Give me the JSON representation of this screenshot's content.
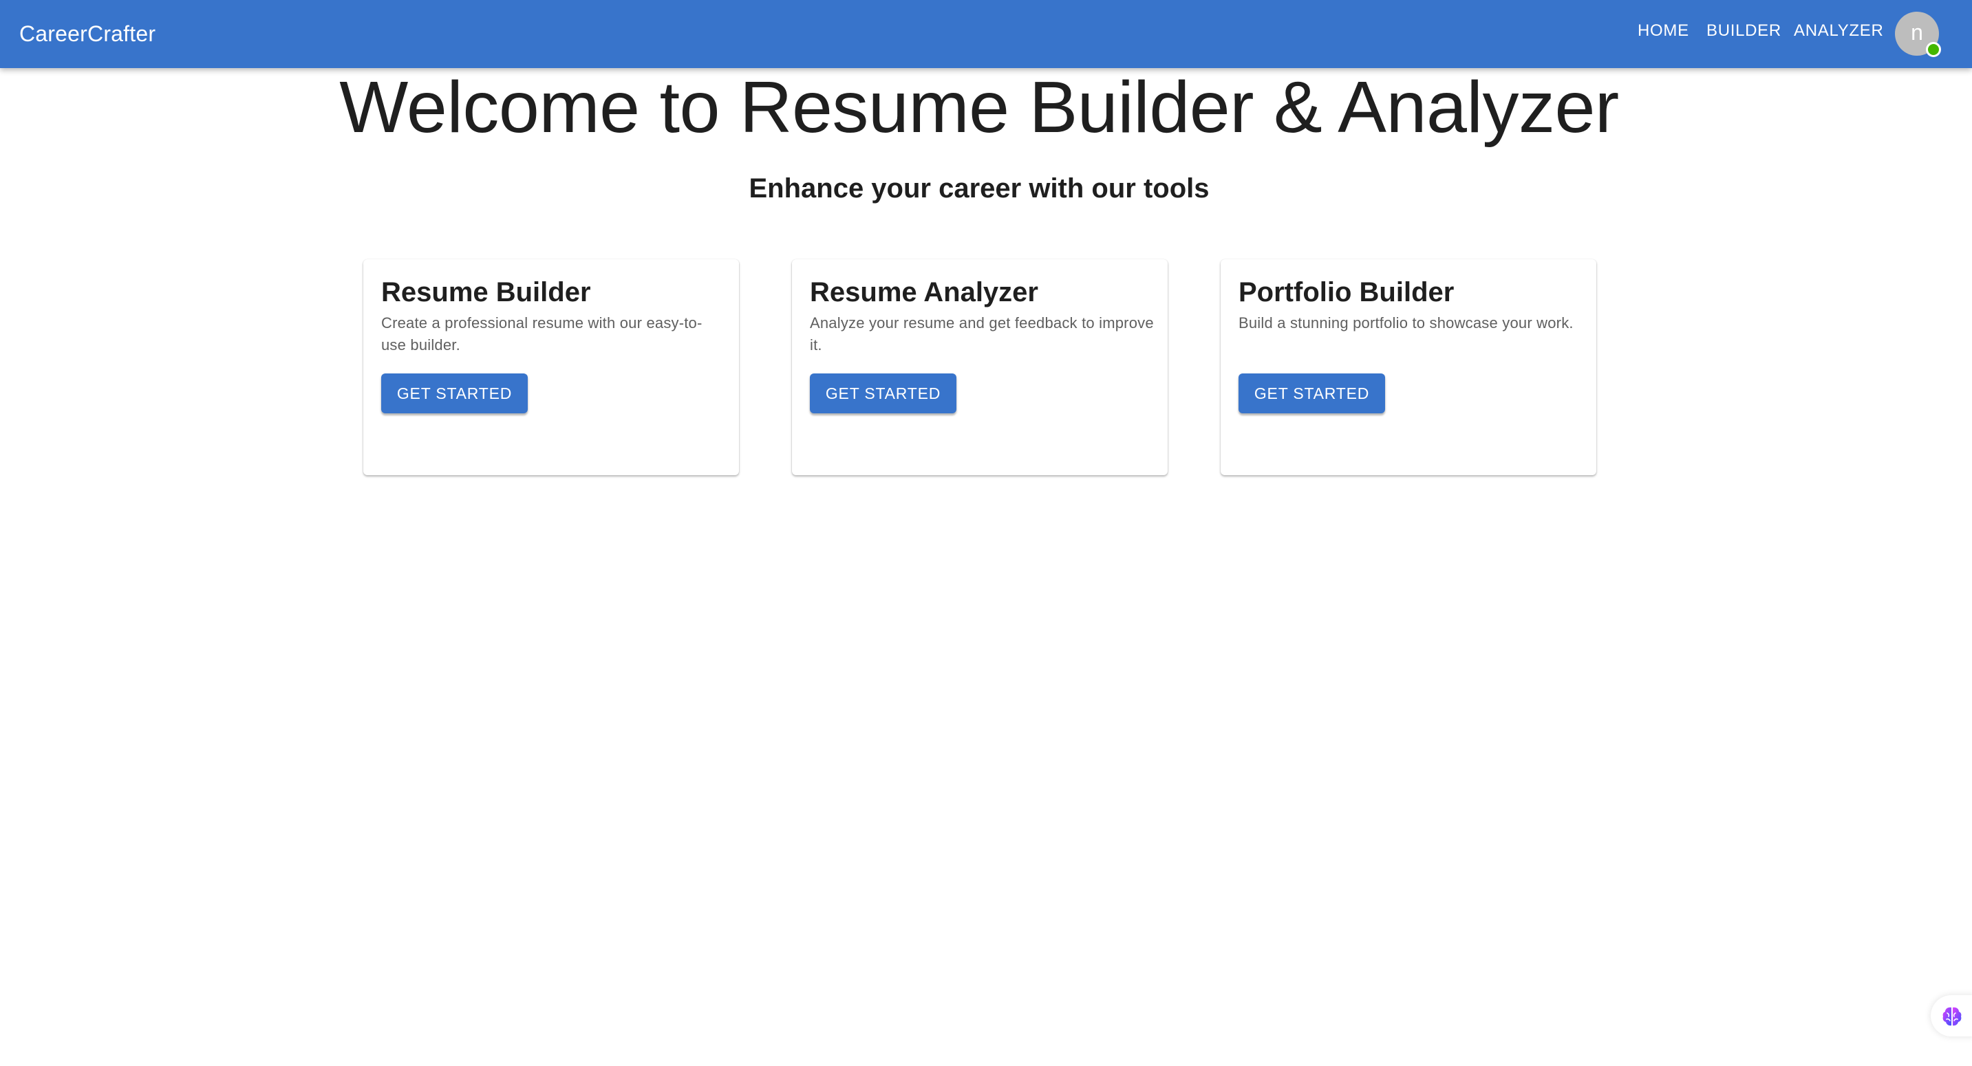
{
  "appbar": {
    "brand": "CareerCrafter",
    "nav": [
      {
        "label": "HOME"
      },
      {
        "label": "BUILDER"
      },
      {
        "label": "ANALYZER"
      }
    ],
    "avatar_initial": "n",
    "avatar_status": "online"
  },
  "hero": {
    "title": "Welcome to Resume Builder & Analyzer",
    "subtitle": "Enhance your career with our tools"
  },
  "cards": [
    {
      "title": "Resume Builder",
      "description": "Create a professional resume with our easy-to-use builder.",
      "button": "GET STARTED"
    },
    {
      "title": "Resume Analyzer",
      "description": "Analyze your resume and get feedback to improve it.",
      "button": "GET STARTED"
    },
    {
      "title": "Portfolio Builder",
      "description": "Build a stunning portfolio to showcase your work.",
      "button": "GET STARTED"
    }
  ],
  "floating_widget": {
    "icon": "brain-icon"
  },
  "colors": {
    "primary": "#3874cb",
    "status_online": "#44b700",
    "avatar_bg": "#bdbdbd"
  }
}
